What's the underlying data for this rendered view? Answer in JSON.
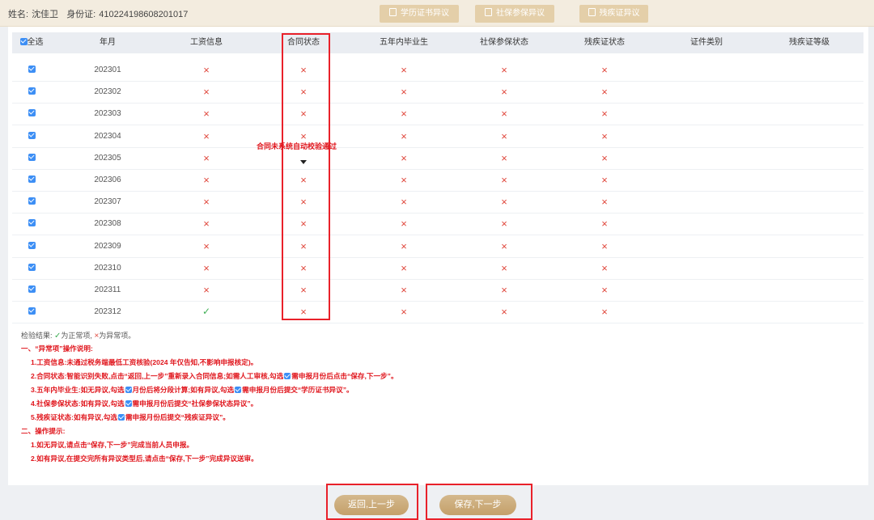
{
  "header": {
    "name_label": "姓名:",
    "name_value": "沈佳卫",
    "id_label": "身份证:",
    "id_value": "410224198608201017",
    "dispute_buttons": [
      "学历证书异议",
      "社保参保异议",
      "残疾证异议"
    ]
  },
  "table": {
    "columns": [
      "全选",
      "年月",
      "工资信息",
      "合同状态",
      "五年内毕业生",
      "社保参保状态",
      "残疾证状态",
      "证件类别",
      "残疾证等级"
    ],
    "rows": [
      {
        "month": "202301",
        "wage": "×",
        "contract": "×",
        "grad": "×",
        "social": "×",
        "disability": "×"
      },
      {
        "month": "202302",
        "wage": "×",
        "contract": "×",
        "grad": "×",
        "social": "×",
        "disability": "×"
      },
      {
        "month": "202303",
        "wage": "×",
        "contract": "×",
        "grad": "×",
        "social": "×",
        "disability": "×"
      },
      {
        "month": "202304",
        "wage": "×",
        "contract": "×",
        "grad": "×",
        "social": "×",
        "disability": "×"
      },
      {
        "month": "202305",
        "wage": "×",
        "contract": "",
        "grad": "×",
        "social": "×",
        "disability": "×"
      },
      {
        "month": "202306",
        "wage": "×",
        "contract": "×",
        "grad": "×",
        "social": "×",
        "disability": "×"
      },
      {
        "month": "202307",
        "wage": "×",
        "contract": "×",
        "grad": "×",
        "social": "×",
        "disability": "×"
      },
      {
        "month": "202308",
        "wage": "×",
        "contract": "×",
        "grad": "×",
        "social": "×",
        "disability": "×"
      },
      {
        "month": "202309",
        "wage": "×",
        "contract": "×",
        "grad": "×",
        "social": "×",
        "disability": "×"
      },
      {
        "month": "202310",
        "wage": "×",
        "contract": "×",
        "grad": "×",
        "social": "×",
        "disability": "×"
      },
      {
        "month": "202311",
        "wage": "×",
        "contract": "×",
        "grad": "×",
        "social": "×",
        "disability": "×"
      },
      {
        "month": "202312",
        "wage": "✓",
        "contract": "×",
        "grad": "×",
        "social": "×",
        "disability": "×"
      }
    ]
  },
  "tooltip": "合同未系统自动校验通过",
  "legend": {
    "prefix": "检验结果:",
    "ok_icon": "✓",
    "ok_text": "为正常项,",
    "x_icon": "×",
    "x_text": "为异常项。"
  },
  "notes": {
    "section1_title": "一、“异常项”操作说明:",
    "n1": "1.工资信息:未通过税务端最低工资核验(2024 年仅告知,不影响申报核定)。",
    "n2_a": "2.合同状态:智能识别失败,点击“返回,上一步”重新录入合同信息;如需人工审核,勾选",
    "n2_b": "需申报月份后点击“保存,下一步”。",
    "n3_a": "3.五年内毕业生:如无异议,勾选",
    "n3_b": "月份后将分段计算;如有异议,勾选",
    "n3_c": "需申报月份后提交“学历证书异议”。",
    "n4_a": "4.社保参保状态:如有异议,勾选",
    "n4_b": "需申报月份后提交“社保参保状态异议”。",
    "n5_a": "5.残疾证状态:如有异议,勾选",
    "n5_b": "需申报月份后提交“残疾证异议”。",
    "section2_title": "二、操作提示:",
    "p1": "1.如无异议,请点击“保存,下一步”完成当前人员申报。",
    "p2": "2.如有异议,在提交完所有异议类型后,请点击“保存,下一步”完成异议送审。"
  },
  "footer": {
    "back_label": "返回,上一步",
    "save_label": "保存,下一步"
  },
  "colors": {
    "accent_gold": "#c9a46c",
    "error_red": "#e0161d",
    "checkbox_blue": "#3d8ff5",
    "ok_green": "#3fae55"
  }
}
